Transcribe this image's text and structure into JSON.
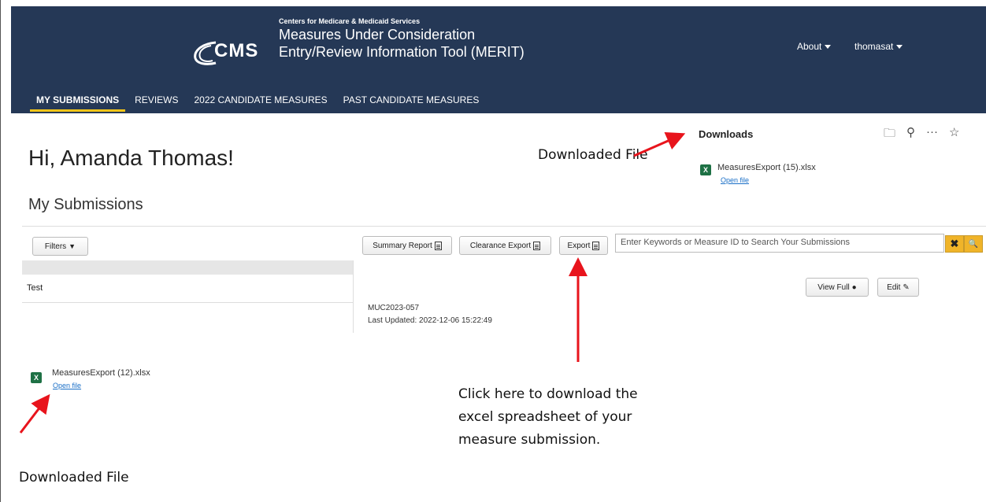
{
  "header": {
    "agency": "Centers for Medicare & Medicaid Services",
    "logo_text": "CMS",
    "title_line1": "Measures Under Consideration",
    "title_line2": "Entry/Review Information Tool (MERIT)",
    "about": "About",
    "user": "thomasat"
  },
  "nav": {
    "tabs": [
      "MY SUBMISSIONS",
      "REVIEWS",
      "2022 CANDIDATE MEASURES",
      "PAST CANDIDATE MEASURES"
    ]
  },
  "main": {
    "greeting": "Hi, Amanda Thomas!",
    "section_title": "My Submissions",
    "filters_label": "Filters",
    "summary_report_label": "Summary Report",
    "clearance_export_label": "Clearance Export",
    "export_label": "Export",
    "search_placeholder": "Enter Keywords or Measure ID to Search Your Submissions",
    "clear_symbol": "✖",
    "search_symbol": "🔍",
    "row_label": "Test",
    "measure_id": "MUC2023-057",
    "last_updated": "Last Updated: 2022-12-06 15:22:49",
    "view_full_label": "View Full",
    "edit_label": "Edit"
  },
  "downloads_panel": {
    "title": "Downloads",
    "file_name": "MeasuresExport (15).xlsx",
    "open_file": "Open file"
  },
  "bottom_download": {
    "file_name": "MeasuresExport (12).xlsx",
    "open_file": "Open file"
  },
  "annotations": {
    "downloaded_file_top": "Downloaded File",
    "downloaded_file_bottom": "Downloaded File",
    "export_hint": [
      "Click here to download the",
      "excel spreadsheet of your",
      "measure submission."
    ]
  },
  "colors": {
    "header_bg": "#253856",
    "nav_active_underline": "#f5c518",
    "search_button": "#f0b429",
    "arrow": "#e8141c",
    "excel_green": "#1e7145"
  }
}
